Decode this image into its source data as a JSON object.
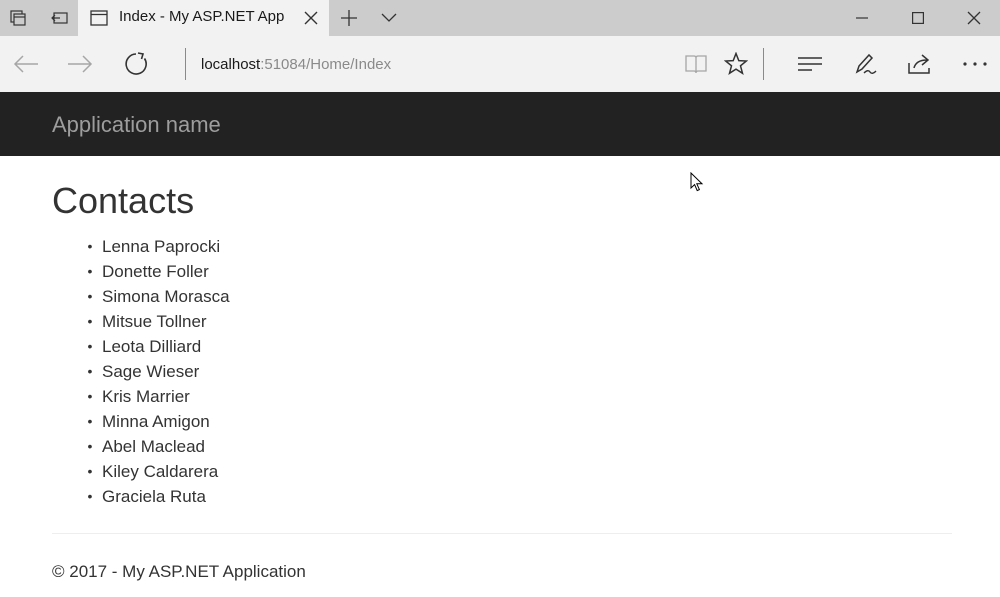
{
  "browser": {
    "tab": {
      "title": "Index - My ASP.NET App"
    },
    "address": {
      "host": "localhost",
      "rest": ":51084/Home/Index"
    }
  },
  "app": {
    "brand": "Application name",
    "page_title": "Contacts",
    "contacts": [
      "Lenna Paprocki",
      "Donette Foller",
      "Simona Morasca",
      "Mitsue Tollner",
      "Leota Dilliard",
      "Sage Wieser",
      "Kris Marrier",
      "Minna Amigon",
      "Abel Maclead",
      "Kiley Caldarera",
      "Graciela Ruta"
    ],
    "footer": "© 2017 - My ASP.NET Application"
  },
  "colors": {
    "navbar": "#222222",
    "brand": "#9d9d9d",
    "chrome": "#cccccc",
    "toolbar": "#f2f2f2"
  }
}
